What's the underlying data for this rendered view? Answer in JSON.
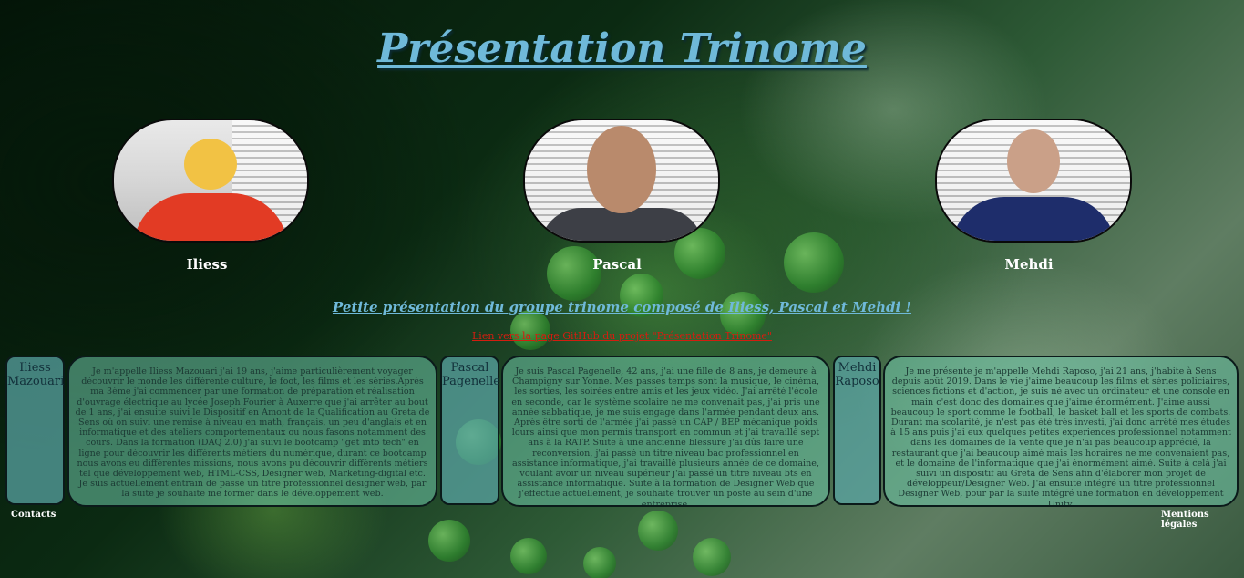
{
  "page": {
    "title": "Présentation Trinome",
    "subtitle": "Petite présentation du groupe trinome composé de Iliess, Pascal et Mehdi !",
    "github_link": "Lien vers la page GitHub du projet \"Présentation Trinome\""
  },
  "members": [
    {
      "first_name": "Iliess",
      "full_name": "Iliess Mazouari",
      "bio": "Je m'appelle Iliess Mazouari j'ai 19 ans, j'aime particulièrement voyager découvrir le monde les différente culture, le foot, les films et les séries.Après ma 3ème j'ai commencer par une formation de préparation et réalisation d'ouvrage électrique au lycée Joseph Fourier à Auxerre que j'ai arrêter au bout de 1 ans, j'ai ensuite suivi le Dispositif en Amont de la Qualification au Greta de Sens où on suivi une remise à niveau en math, français, un peu d'anglais et en informatique et des ateliers comportementaux ou nous fasons notamment des cours. Dans la formation (DAQ 2.0) j'ai suivi le bootcamp \"get into tech\" en ligne pour découvrir les différents métiers du numérique, durant ce bootcamp nous avons eu différentes missions, nous avons pu découvrir différents métiers tel que développement web, HTML-CSS, Designer web, Marketing-digital etc. Je suis actuellement entrain de passe un titre professionnel designer web, par la suite je souhaite me former dans le développement web."
    },
    {
      "first_name": "Pascal",
      "full_name": "Pascal Pagenelle",
      "bio": "Je suis Pascal Pagenelle, 42 ans, j'ai une fille de 8 ans, je demeure à Champigny sur Yonne. Mes passes temps sont la musique, le cinéma, les sorties, les soirées entre amis et les jeux vidéo. J'ai arrêté l'école en seconde, car le système scolaire ne me convenait pas, j'ai pris une année sabbatique, je me suis engagé dans l'armée pendant deux ans. Après être sorti de l'armée j'ai passé un CAP / BEP mécanique poids lours ainsi que mon permis transport en commun et j'ai travaillé sept ans à la RATP. Suite à une ancienne blessure j'ai dûs faire une reconversion, j'ai passé un titre niveau bac professionnel en assistance informatique, j'ai travaillé plusieurs année de ce domaine, voulant avoir un niveau supérieur j'ai passé un titre niveau bts en assistance informatique. Suite à la formation de Designer Web que j'effectue actuellement, je souhaite trouver un poste au sein d'une entreprise."
    },
    {
      "first_name": "Mehdi",
      "full_name": "Mehdi Raposo",
      "bio": "Je me présente je m'appelle Mehdi Raposo, j'ai 21 ans, j'habite à Sens depuis août 2019. Dans le vie j'aime beaucoup les films et séries policiaires, sciences fictions et d'action, je suis né avec un ordinateur et une console en main c'est donc des domaines que j'aime énormément. J'aime aussi beaucoup le sport comme le football, le basket ball et les sports de combats. Durant ma scolarité, je n'est pas été très investi, j'ai donc arrêté mes études à 15 ans puis j'ai eux quelques petites experiences professionnel notamment dans les domaines de la vente que je n'ai pas beaucoup apprécié, la restaurant que j'ai beaucoup aimé mais les horaires ne me convenaient pas, et le domaine de l'informatique que j'ai énormément aimé. Suite à celà j'ai suivi un dispositif au Greta de Sens afin d'élaborer mon projet de développeur/Designer Web. J'ai ensuite intégré un titre professionnel Designer Web, pour par la suite intégré une formation en développement Unity."
    }
  ],
  "footer": {
    "contacts": "Contacts",
    "legal": "Mentions légales"
  },
  "colors": {
    "title": "#6fb9d9",
    "link": "#d41d10"
  }
}
